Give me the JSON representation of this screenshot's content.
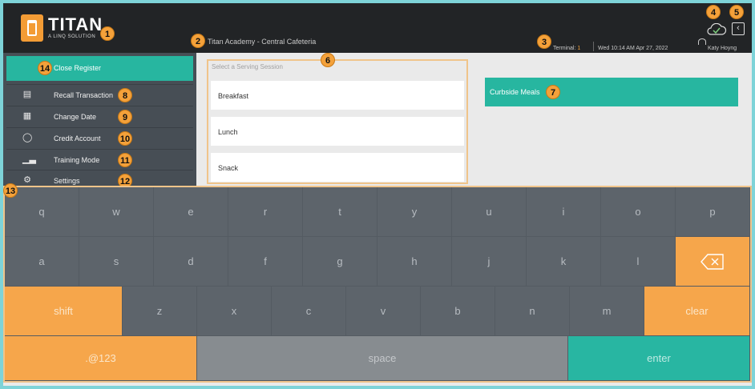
{
  "header": {
    "brand": "TITAN",
    "brand_sub": "A LINQ SOLUTION",
    "school": "Titan Academy - Central Cafeteria",
    "terminal_label": "Terminal:",
    "terminal_number": "1",
    "datetime": "Wed 10:14 AM Apr 27, 2022",
    "user": "Katy Hoyng"
  },
  "badges": [
    "1",
    "2",
    "3",
    "4",
    "5",
    "6",
    "7",
    "8",
    "9",
    "10",
    "11",
    "12",
    "13",
    "14"
  ],
  "sidebar": {
    "close_register": "Close Register",
    "items": [
      {
        "label": "Recall Transaction",
        "icon": "receipt-icon"
      },
      {
        "label": "Change Date",
        "icon": "calendar-icon"
      },
      {
        "label": "Credit Account",
        "icon": "piggy-bank-icon"
      },
      {
        "label": "Training Mode",
        "icon": "bar-chart-icon"
      },
      {
        "label": "Settings",
        "icon": "gear-icon"
      }
    ]
  },
  "session": {
    "placeholder": "Select a Serving Session",
    "items": [
      "Breakfast",
      "Lunch",
      "Snack"
    ]
  },
  "curbside": "Curbside Meals",
  "keyboard": {
    "row1": [
      "q",
      "w",
      "e",
      "r",
      "t",
      "y",
      "u",
      "i",
      "o",
      "p"
    ],
    "row2": [
      "a",
      "s",
      "d",
      "f",
      "g",
      "h",
      "j",
      "k",
      "l"
    ],
    "shift": "shift",
    "row3": [
      "z",
      "x",
      "c",
      "v",
      "b",
      "n",
      "m"
    ],
    "clear": "clear",
    "sym": ".@123",
    "space": "space",
    "enter": "enter"
  },
  "colors": {
    "accent_teal": "#27b6a0",
    "accent_orange": "#f6a64b",
    "topbar": "#222426",
    "sidebar": "#474e55"
  }
}
